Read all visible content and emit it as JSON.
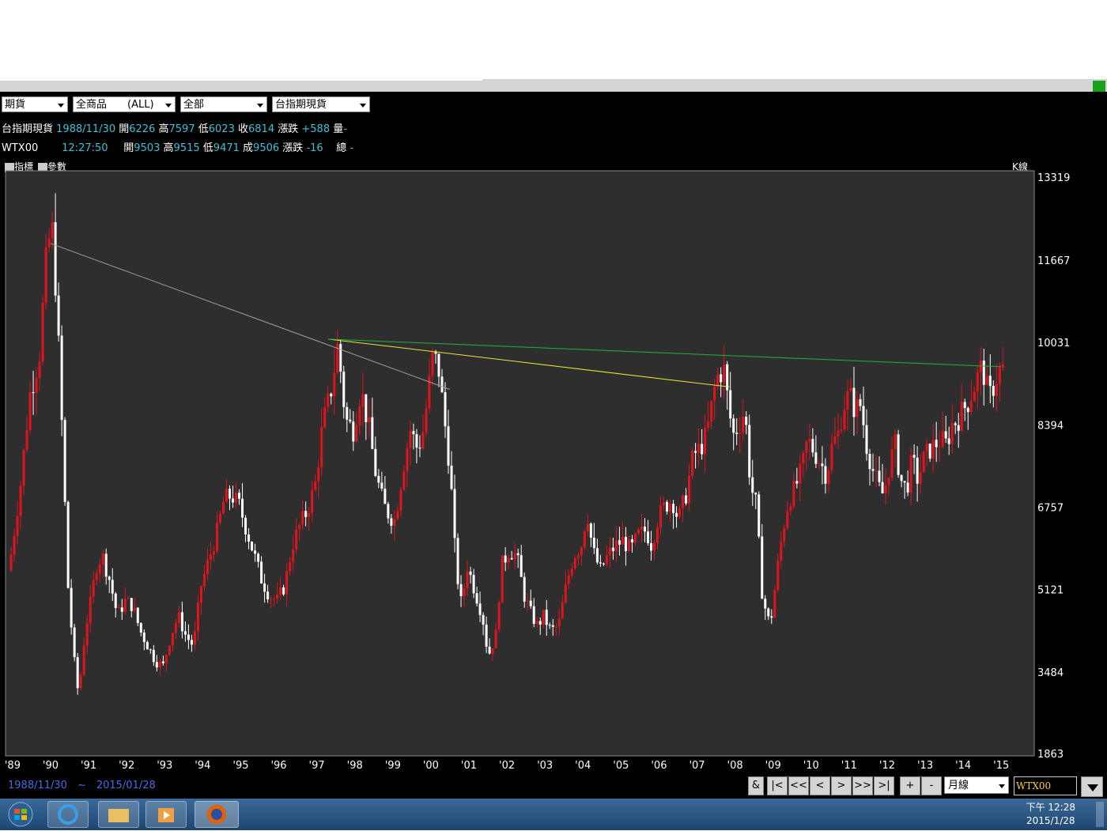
{
  "toolbar": {
    "market": "期貨",
    "product": "全商品　　(ALL)",
    "scope": "全部",
    "symbol_select": "台指期現貨"
  },
  "quote1": {
    "name": "台指期現貨",
    "date": "1988/11/30",
    "open_label": "開",
    "open": "6226",
    "high_label": "高",
    "high": "7597",
    "low_label": "低",
    "low": "6023",
    "close_label": "收",
    "close": "6814",
    "change_label": "漲跌",
    "change": "+588",
    "volume_label": "量",
    "volume": "-"
  },
  "quote2": {
    "name": "WTX00",
    "time": "12:27:50",
    "open_label": "開",
    "open": "9503",
    "high_label": "高",
    "high": "9515",
    "low_label": "低",
    "low": "9471",
    "trade_label": "成",
    "trade": "9506",
    "change_label": "漲跌",
    "change": "-16",
    "total_label": "總",
    "total": "-"
  },
  "chart_toolbar": {
    "indicator_label": "指標",
    "param_label": "參數",
    "chart_type_label": "K線"
  },
  "chart_data": {
    "type": "candlestick",
    "y_ticks": [
      13319,
      11667,
      10031,
      8394,
      6757,
      5121,
      3484,
      1863
    ],
    "ylim": [
      1863,
      13319
    ],
    "x_ticks": [
      "'89",
      "'90",
      "'91",
      "'92",
      "'93",
      "'94",
      "'95",
      "'96",
      "'97",
      "'98",
      "'99",
      "'00",
      "'01",
      "'02",
      "'03",
      "'04",
      "'05",
      "'06",
      "'07",
      "'08",
      "'09",
      "'10",
      "'11",
      "'12",
      "'13",
      "'14",
      "'15"
    ],
    "x_start_year": 1988.92,
    "x_end_year": 2015.08,
    "colors": {
      "up": "#e0141e",
      "down": "#ffffff",
      "grid_bg": "#2e2e2e"
    },
    "monthly_close": [
      [
        1988.92,
        5500
      ],
      [
        1989.0,
        5800
      ],
      [
        1989.25,
        7200
      ],
      [
        1989.5,
        9000
      ],
      [
        1989.75,
        9800
      ],
      [
        1989.95,
        11900
      ],
      [
        1990.08,
        12300
      ],
      [
        1990.2,
        10900
      ],
      [
        1990.35,
        8200
      ],
      [
        1990.5,
        5200
      ],
      [
        1990.65,
        3800
      ],
      [
        1990.78,
        3000
      ],
      [
        1990.95,
        4300
      ],
      [
        1991.1,
        4900
      ],
      [
        1991.25,
        5600
      ],
      [
        1991.4,
        5800
      ],
      [
        1991.6,
        5300
      ],
      [
        1991.8,
        4600
      ],
      [
        1992.0,
        4900
      ],
      [
        1992.2,
        4800
      ],
      [
        1992.4,
        4300
      ],
      [
        1992.6,
        4000
      ],
      [
        1992.8,
        3700
      ],
      [
        1993.0,
        3600
      ],
      [
        1993.2,
        4200
      ],
      [
        1993.4,
        4600
      ],
      [
        1993.6,
        4200
      ],
      [
        1993.8,
        4000
      ],
      [
        1994.0,
        5200
      ],
      [
        1994.2,
        5700
      ],
      [
        1994.4,
        6200
      ],
      [
        1994.6,
        6900
      ],
      [
        1994.8,
        7000
      ],
      [
        1995.0,
        6800
      ],
      [
        1995.2,
        6300
      ],
      [
        1995.4,
        5800
      ],
      [
        1995.6,
        5300
      ],
      [
        1995.8,
        5000
      ],
      [
        1996.0,
        4900
      ],
      [
        1996.2,
        5200
      ],
      [
        1996.4,
        6000
      ],
      [
        1996.6,
        6400
      ],
      [
        1996.8,
        6700
      ],
      [
        1997.0,
        7200
      ],
      [
        1997.2,
        8400
      ],
      [
        1997.4,
        9000
      ],
      [
        1997.6,
        10000
      ],
      [
        1997.8,
        8500
      ],
      [
        1998.0,
        8300
      ],
      [
        1998.2,
        9100
      ],
      [
        1998.4,
        8400
      ],
      [
        1998.6,
        7400
      ],
      [
        1998.8,
        6800
      ],
      [
        1998.95,
        6600
      ],
      [
        1999.1,
        6500
      ],
      [
        1999.3,
        7500
      ],
      [
        1999.5,
        8300
      ],
      [
        1999.7,
        7900
      ],
      [
        1999.85,
        8300
      ],
      [
        2000.0,
        9200
      ],
      [
        2000.1,
        9800
      ],
      [
        2000.25,
        9500
      ],
      [
        2000.4,
        8500
      ],
      [
        2000.55,
        7500
      ],
      [
        2000.7,
        5600
      ],
      [
        2000.85,
        4800
      ],
      [
        2001.0,
        5600
      ],
      [
        2001.2,
        5100
      ],
      [
        2001.4,
        4600
      ],
      [
        2001.55,
        3800
      ],
      [
        2001.75,
        4200
      ],
      [
        2001.9,
        5600
      ],
      [
        2002.1,
        5900
      ],
      [
        2002.3,
        5800
      ],
      [
        2002.5,
        5000
      ],
      [
        2002.7,
        4600
      ],
      [
        2002.85,
        4400
      ],
      [
        2003.0,
        4600
      ],
      [
        2003.2,
        4300
      ],
      [
        2003.4,
        4400
      ],
      [
        2003.6,
        5200
      ],
      [
        2003.8,
        5800
      ],
      [
        2004.0,
        6000
      ],
      [
        2004.15,
        6700
      ],
      [
        2004.3,
        5900
      ],
      [
        2004.5,
        5500
      ],
      [
        2004.7,
        5800
      ],
      [
        2004.9,
        6000
      ],
      [
        2005.1,
        6100
      ],
      [
        2005.3,
        5900
      ],
      [
        2005.5,
        6200
      ],
      [
        2005.7,
        6300
      ],
      [
        2005.85,
        6000
      ],
      [
        2006.0,
        6500
      ],
      [
        2006.2,
        6800
      ],
      [
        2006.4,
        6900
      ],
      [
        2006.55,
        6500
      ],
      [
        2006.75,
        7000
      ],
      [
        2006.95,
        7800
      ],
      [
        2007.1,
        7900
      ],
      [
        2007.3,
        8200
      ],
      [
        2007.5,
        9100
      ],
      [
        2007.6,
        9400
      ],
      [
        2007.75,
        9500
      ],
      [
        2007.9,
        8600
      ],
      [
        2008.0,
        8200
      ],
      [
        2008.15,
        8400
      ],
      [
        2008.3,
        8700
      ],
      [
        2008.45,
        7200
      ],
      [
        2008.6,
        6800
      ],
      [
        2008.75,
        5100
      ],
      [
        2008.9,
        4500
      ],
      [
        2009.0,
        4600
      ],
      [
        2009.15,
        5500
      ],
      [
        2009.3,
        6300
      ],
      [
        2009.45,
        6900
      ],
      [
        2009.6,
        7100
      ],
      [
        2009.8,
        7500
      ],
      [
        2009.95,
        8100
      ],
      [
        2010.1,
        7900
      ],
      [
        2010.25,
        7700
      ],
      [
        2010.45,
        7400
      ],
      [
        2010.6,
        8000
      ],
      [
        2010.75,
        8200
      ],
      [
        2010.9,
        8800
      ],
      [
        2011.05,
        9000
      ],
      [
        2011.2,
        8700
      ],
      [
        2011.35,
        8800
      ],
      [
        2011.5,
        8000
      ],
      [
        2011.7,
        7400
      ],
      [
        2011.85,
        7100
      ],
      [
        2011.95,
        7000
      ],
      [
        2012.1,
        7600
      ],
      [
        2012.25,
        8000
      ],
      [
        2012.4,
        7300
      ],
      [
        2012.55,
        7100
      ],
      [
        2012.7,
        7700
      ],
      [
        2012.85,
        7300
      ],
      [
        2013.0,
        7700
      ],
      [
        2013.15,
        7900
      ],
      [
        2013.3,
        8000
      ],
      [
        2013.45,
        8100
      ],
      [
        2013.6,
        8000
      ],
      [
        2013.75,
        8400
      ],
      [
        2013.9,
        8500
      ],
      [
        2014.05,
        8700
      ],
      [
        2014.2,
        8900
      ],
      [
        2014.35,
        9200
      ],
      [
        2014.5,
        9500
      ],
      [
        2014.6,
        9400
      ],
      [
        2014.72,
        8900
      ],
      [
        2014.85,
        9200
      ],
      [
        2014.95,
        9400
      ],
      [
        2015.05,
        9500
      ]
    ],
    "trendlines": [
      {
        "from": [
          1990.0,
          12000
        ],
        "to": [
          2000.5,
          9100
        ],
        "color": "#a0a0a0"
      },
      {
        "from": [
          1997.3,
          10100
        ],
        "to": [
          2007.85,
          9150
        ],
        "color": "#e8e830"
      },
      {
        "from": [
          1997.3,
          10100
        ],
        "to": [
          2015.0,
          9550
        ],
        "color": "#20b040"
      }
    ]
  },
  "footer": {
    "date_range": "1988/11/30　~　2015/01/28",
    "btn_amp": "&",
    "btn_first": "|<",
    "btn_prevprev": "<<",
    "btn_prev": "<",
    "btn_next": ">",
    "btn_nextnext": ">>",
    "btn_last": ">|",
    "btn_plus": "+",
    "btn_minus": "-",
    "period": "月線",
    "symbol": "WTX00"
  },
  "taskbar": {
    "time": "下午 12:28",
    "date": "2015/1/28"
  }
}
